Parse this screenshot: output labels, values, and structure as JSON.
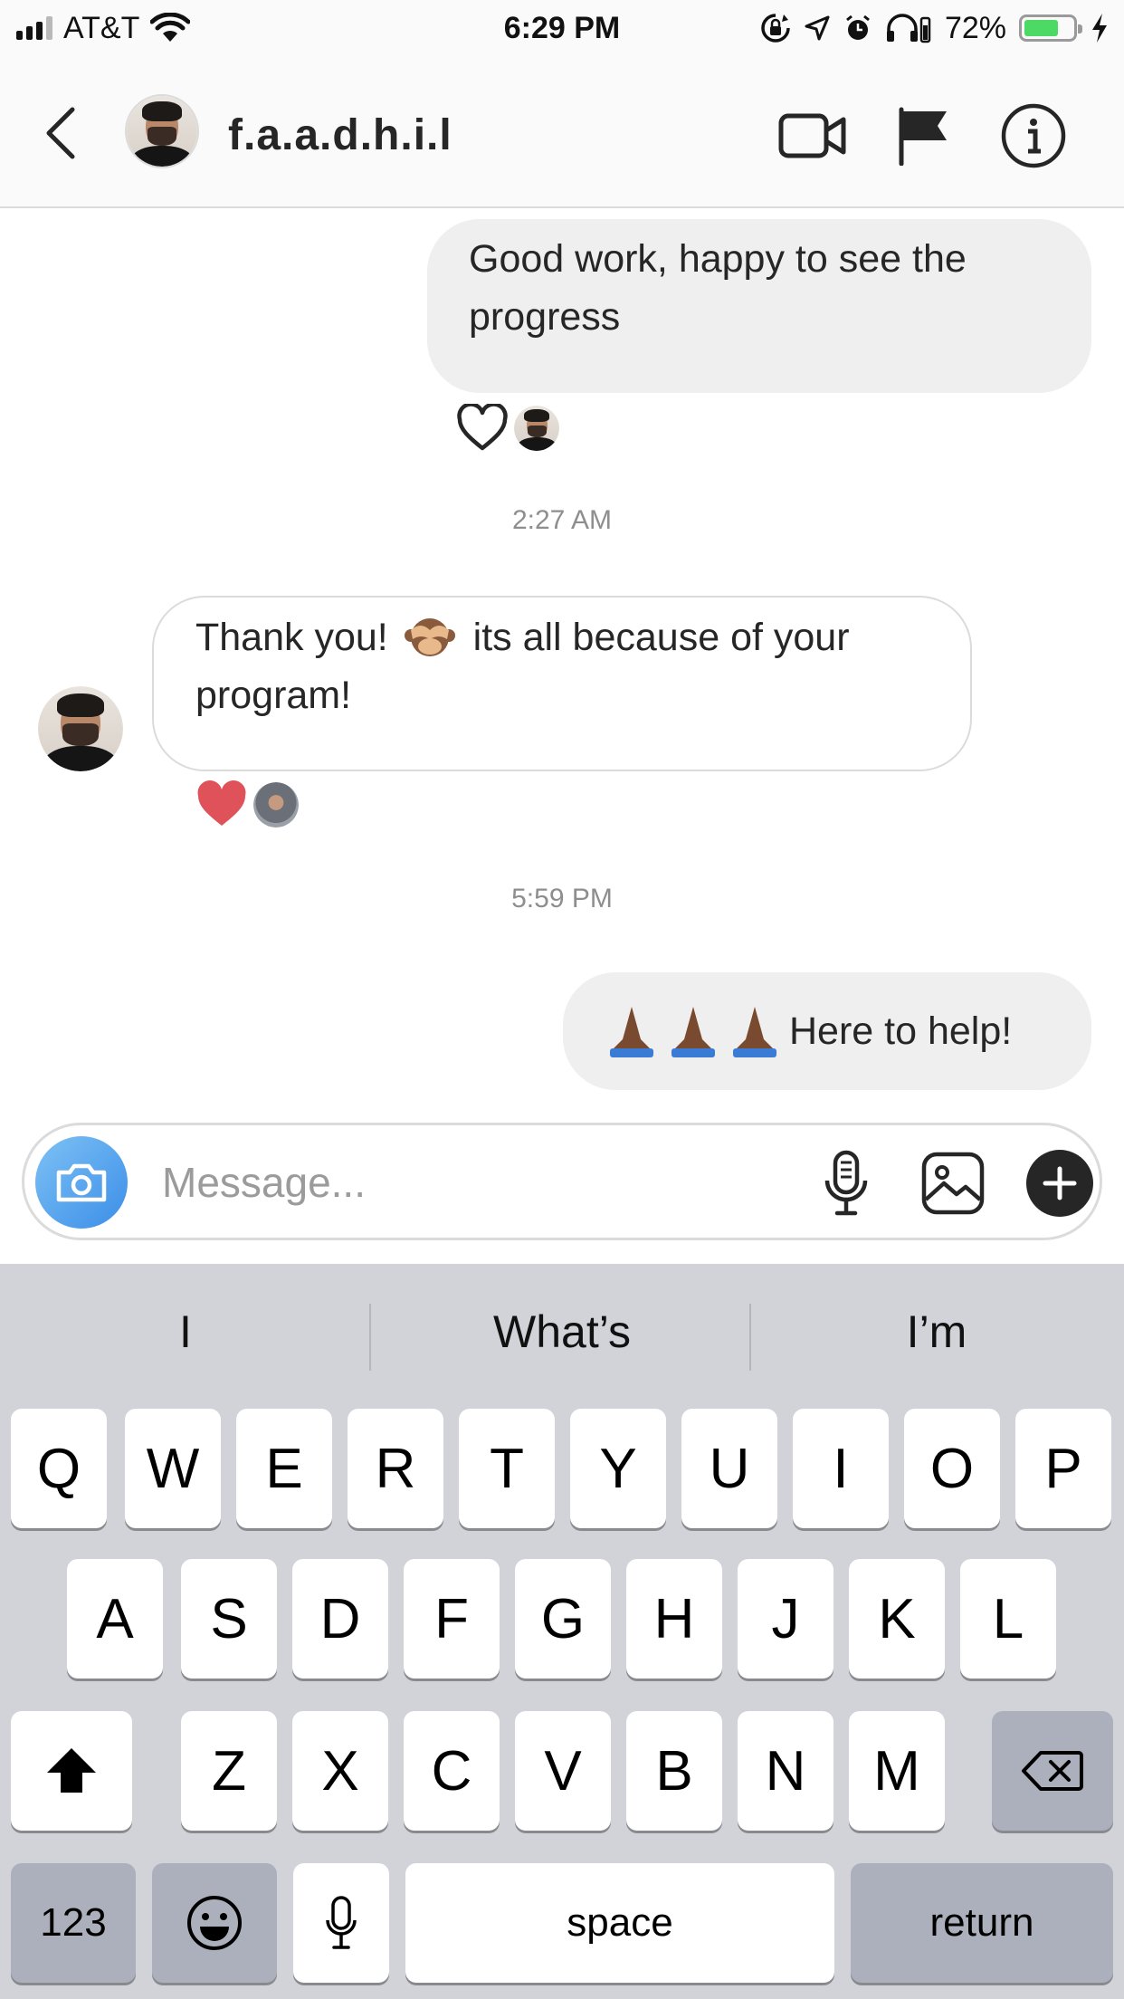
{
  "status_bar": {
    "carrier": "AT&T",
    "time": "6:29 PM",
    "battery_percent": "72%",
    "battery_level": 0.72,
    "icons": [
      "signal-icon",
      "wifi-icon",
      "rotation-lock-icon",
      "location-icon",
      "alarm-icon",
      "headphones-icon",
      "battery-icon",
      "charging-icon"
    ]
  },
  "header": {
    "username": "f.a.a.d.h.i.l",
    "icons": [
      "back-icon",
      "video-call-icon",
      "flag-icon",
      "info-icon"
    ]
  },
  "messages": [
    {
      "direction": "outgoing",
      "text": "Good work, happy to see the progress",
      "reaction": "outline-heart",
      "reactor": "f.a.a.d.h.i.l"
    },
    {
      "timestamp": "2:27 AM"
    },
    {
      "direction": "incoming",
      "text_before_emoji": "Thank you!",
      "emoji": "see-no-evil-monkey",
      "text_after_emoji": "its all because of your program!",
      "reaction": "red-heart"
    },
    {
      "timestamp": "5:59 PM"
    },
    {
      "direction": "outgoing",
      "emoji": "folded-hands x3",
      "text": "Here to help!"
    }
  ],
  "composer": {
    "placeholder": "Message...",
    "icons": [
      "camera-icon",
      "microphone-icon",
      "gallery-icon",
      "plus-icon"
    ]
  },
  "keyboard": {
    "suggestions": [
      "I",
      "What’s",
      "I’m"
    ],
    "row1": [
      "Q",
      "W",
      "E",
      "R",
      "T",
      "Y",
      "U",
      "I",
      "O",
      "P"
    ],
    "row2": [
      "A",
      "S",
      "D",
      "F",
      "G",
      "H",
      "J",
      "K",
      "L"
    ],
    "row3": [
      "Z",
      "X",
      "C",
      "V",
      "B",
      "N",
      "M"
    ],
    "numbers_key": "123",
    "space_key": "space",
    "return_key": "return"
  },
  "colors": {
    "reaction_heart": "#e0525a",
    "camera_button": "#3b8ee8",
    "outgoing_bubble": "#efefef",
    "keyboard_bg": "#d1d3d9",
    "battery_fill": "#4cd964"
  }
}
